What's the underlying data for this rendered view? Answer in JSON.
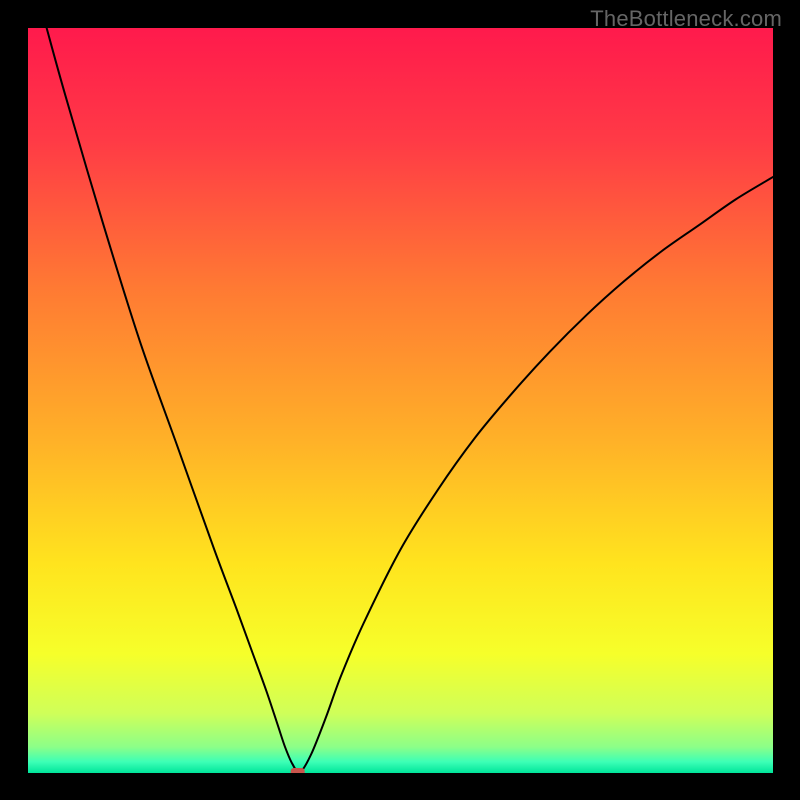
{
  "watermark": "TheBottleneck.com",
  "chart_data": {
    "type": "line",
    "title": "",
    "xlabel": "",
    "ylabel": "",
    "xlim": [
      0,
      100
    ],
    "ylim": [
      0,
      100
    ],
    "grid": false,
    "series": [
      {
        "name": "curve",
        "x": [
          2.5,
          5,
          10,
          15,
          20,
          25,
          28,
          30,
          32,
          33.5,
          34.5,
          35.5,
          36.5,
          38,
          40,
          42,
          45,
          50,
          55,
          60,
          65,
          70,
          75,
          80,
          85,
          90,
          95,
          100
        ],
        "y": [
          100,
          91,
          74,
          58,
          44,
          30,
          22,
          16.5,
          11,
          6.5,
          3.5,
          1.2,
          0.1,
          2.5,
          7.5,
          13,
          20,
          30,
          38,
          45,
          51,
          56.5,
          61.5,
          66,
          70,
          73.5,
          77,
          80
        ]
      }
    ],
    "marker": {
      "x": 36.2,
      "y": 0.0
    },
    "background": {
      "type": "vertical-gradient",
      "stops": [
        {
          "offset": 0.0,
          "color": "#ff1a4c"
        },
        {
          "offset": 0.15,
          "color": "#ff3a46"
        },
        {
          "offset": 0.35,
          "color": "#ff7a33"
        },
        {
          "offset": 0.55,
          "color": "#ffb028"
        },
        {
          "offset": 0.72,
          "color": "#ffe41e"
        },
        {
          "offset": 0.84,
          "color": "#f6ff2a"
        },
        {
          "offset": 0.92,
          "color": "#cfff59"
        },
        {
          "offset": 0.965,
          "color": "#8cff88"
        },
        {
          "offset": 0.985,
          "color": "#3dffb6"
        },
        {
          "offset": 1.0,
          "color": "#00e59a"
        }
      ]
    }
  }
}
